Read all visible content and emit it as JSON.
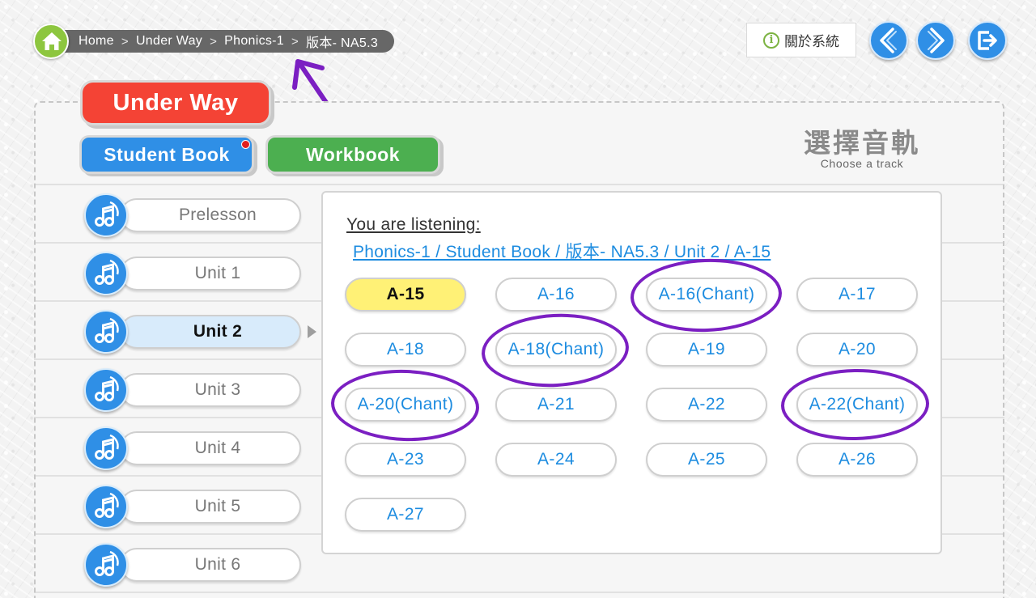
{
  "breadcrumb": {
    "items": [
      "Home",
      "Under Way",
      "Phonics-1",
      "版本- NA5.3"
    ],
    "separator": ">"
  },
  "toolbar": {
    "about_label": "關於系統",
    "about_icon": "i"
  },
  "header": {
    "title": "Under Way",
    "tabs": [
      {
        "label": "Student Book",
        "color": "#2f8fe6",
        "has_notification_dot": true
      },
      {
        "label": "Workbook",
        "color": "#4caf50"
      }
    ],
    "choose_title": "選擇音軌",
    "choose_subtitle": "Choose a track"
  },
  "units": [
    {
      "label": "Prelesson"
    },
    {
      "label": "Unit 1"
    },
    {
      "label": "Unit 2",
      "selected": true
    },
    {
      "label": "Unit 3"
    },
    {
      "label": "Unit 4"
    },
    {
      "label": "Unit 5"
    },
    {
      "label": "Unit 6"
    }
  ],
  "listening": {
    "label": "You are listening:",
    "path": "Phonics-1 / Student Book / 版本- NA5.3 / Unit 2 / A-15"
  },
  "tracks": [
    {
      "label": "A-15",
      "current": true
    },
    {
      "label": "A-16"
    },
    {
      "label": "A-16(Chant)",
      "circled": true
    },
    {
      "label": "A-17"
    },
    {
      "label": "A-18"
    },
    {
      "label": "A-18(Chant)",
      "circled": true
    },
    {
      "label": "A-19"
    },
    {
      "label": "A-20"
    },
    {
      "label": "A-20(Chant)",
      "circled": true
    },
    {
      "label": "A-21"
    },
    {
      "label": "A-22"
    },
    {
      "label": "A-22(Chant)",
      "circled": true
    },
    {
      "label": "A-23"
    },
    {
      "label": "A-24"
    },
    {
      "label": "A-25"
    },
    {
      "label": "A-26"
    },
    {
      "label": "A-27"
    }
  ],
  "colors": {
    "accent_blue": "#2f8fe6",
    "title_red": "#f44335",
    "workbook_green": "#4caf50",
    "current_track": "#fff176",
    "annotation_purple": "#7b1fc2",
    "link_blue": "#1d8ce0"
  },
  "icons": {
    "home": "home-icon",
    "back": "chevron-left-icon",
    "forward": "chevron-right-icon",
    "exit": "exit-icon",
    "unit": "music-note-icon",
    "info": "info-icon"
  }
}
